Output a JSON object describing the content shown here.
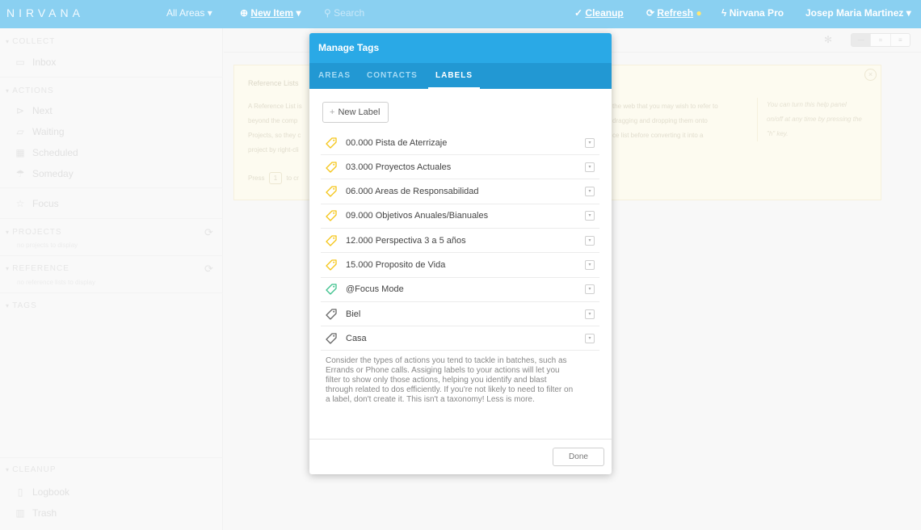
{
  "topbar": {
    "logo": "NIRVANA",
    "areas": "All Areas ▾",
    "new_item": "New Item",
    "new_item_caret": "▾",
    "search_placeholder": "Search",
    "cleanup": "Cleanup",
    "refresh": "Refresh",
    "refresh_dot": "●",
    "pro": "Nirvana Pro",
    "user": "Josep Maria Martinez ▾"
  },
  "sidebar": {
    "collect": "COLLECT",
    "inbox": "Inbox",
    "actions": "ACTIONS",
    "next": "Next",
    "waiting": "Waiting",
    "scheduled": "Scheduled",
    "someday": "Someday",
    "focus": "Focus",
    "projects": "PROJECTS",
    "projects_empty": "no projects to display",
    "reference": "REFERENCE",
    "reference_empty": "no reference lists to display",
    "tags": "TAGS",
    "cleanup": "CLEANUP",
    "logbook": "Logbook",
    "trash": "Trash"
  },
  "help": {
    "title": "Reference Lists",
    "body1": "A Reference List is",
    "body2": "beyond the comp",
    "body3": "Projects, so they c",
    "body4": "project by right-cli",
    "right1": "the web that you may wish to refer to",
    "right2": "dragging and dropping them onto",
    "right3": "ce list before converting it into a",
    "press": "Press",
    "press_key": "1",
    "press_rest": "to cr",
    "side": "You can turn this help panel on/off at any time by pressing the \"h\" key.",
    "close": "×"
  },
  "modal": {
    "title": "Manage Tags",
    "tabs": [
      "AREAS",
      "CONTACTS",
      "LABELS"
    ],
    "new_label": "New Label",
    "labels": [
      {
        "name": "00.000 Pista de Aterrizaje",
        "color": "#f5c518"
      },
      {
        "name": "03.000 Proyectos Actuales",
        "color": "#f5c518"
      },
      {
        "name": "06.000 Areas de Responsabilidad",
        "color": "#f5c518"
      },
      {
        "name": "09.000 Objetivos Anuales/Bianuales",
        "color": "#f5c518"
      },
      {
        "name": "12.000 Perspectiva 3 a 5 años",
        "color": "#f5c518"
      },
      {
        "name": "15.000 Proposito de Vida",
        "color": "#f5c518"
      },
      {
        "name": "@Focus Mode",
        "color": "#3cc18c"
      },
      {
        "name": "Biel",
        "color": "#666666"
      },
      {
        "name": "Casa",
        "color": "#666666"
      }
    ],
    "description": "Consider the types of actions you tend to tackle in batches, such as Errands or Phone calls. Assiging labels to your actions will let you filter to show only those actions, helping you identify and blast through related to dos efficiently. If you're not likely to need to filter on a label, don't create it. This isn't a taxonomy! Less is more.",
    "done": "Done"
  },
  "colors": {
    "accent": "#2aa9e6",
    "tab_bar": "#2298d3",
    "label_yellow": "#f5c518",
    "label_green": "#3cc18c"
  }
}
